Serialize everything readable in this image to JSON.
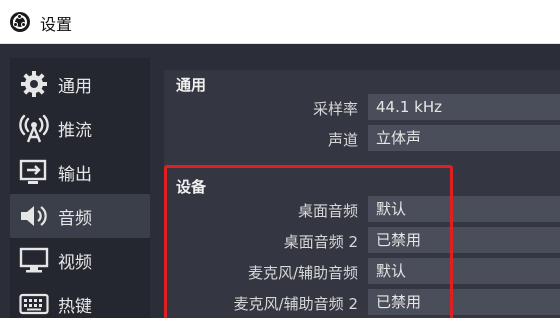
{
  "window": {
    "title": "设置"
  },
  "sidebar": {
    "items": [
      {
        "label": "通用",
        "icon": "gear-icon"
      },
      {
        "label": "推流",
        "icon": "broadcast-icon"
      },
      {
        "label": "输出",
        "icon": "output-icon"
      },
      {
        "label": "音频",
        "icon": "speaker-icon",
        "active": true
      },
      {
        "label": "视频",
        "icon": "monitor-icon"
      },
      {
        "label": "热键",
        "icon": "keyboard-icon"
      }
    ]
  },
  "general": {
    "title": "通用",
    "sample_rate_label": "采样率",
    "sample_rate_value": "44.1 kHz",
    "channels_label": "声道",
    "channels_value": "立体声"
  },
  "devices": {
    "title": "设备",
    "desktop_audio_label": "桌面音频",
    "desktop_audio_value": "默认",
    "desktop_audio2_label": "桌面音频 2",
    "desktop_audio2_value": "已禁用",
    "mic_label": "麦克风/辅助音频",
    "mic_value": "默认",
    "mic2_label": "麦克风/辅助音频 2",
    "mic2_value": "已禁用"
  }
}
